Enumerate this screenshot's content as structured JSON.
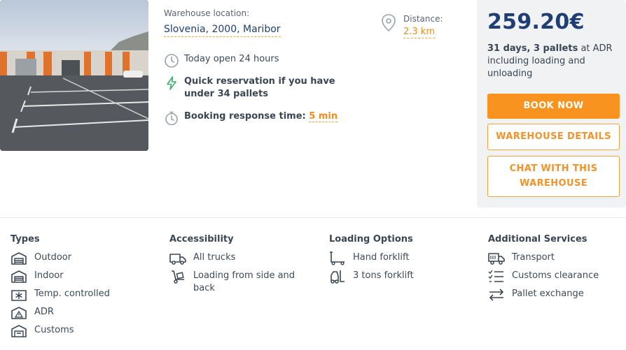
{
  "listing": {
    "location_label": "Warehouse location:",
    "location_value": "Slovenia, 2000, Maribor",
    "distance_label": "Distance:",
    "distance_value": "2.3 km",
    "open_hours": "Today open 24 hours",
    "quick_reservation": "Quick reservation if you have under 34 pallets",
    "response_label": "Booking response time:",
    "response_value": "5 min"
  },
  "pricing": {
    "price": "259.20€",
    "terms_bold": "31 days, 3 pallets",
    "terms_rest": " at ADR",
    "terms_note": "including loading and unloading",
    "book_label": "BOOK NOW",
    "details_label": "WAREHOUSE DETAILS",
    "chat_label": "CHAT WITH THIS WAREHOUSE"
  },
  "features": {
    "types": {
      "title": "Types",
      "items": [
        {
          "label": "Outdoor",
          "icon": "outdoor-warehouse-icon"
        },
        {
          "label": "Indoor",
          "icon": "indoor-warehouse-icon"
        },
        {
          "label": "Temp. controlled",
          "icon": "snowflake-icon"
        },
        {
          "label": "ADR",
          "icon": "hazard-warning-icon"
        },
        {
          "label": "Customs",
          "icon": "customs-warehouse-icon"
        }
      ]
    },
    "accessibility": {
      "title": "Accessibility",
      "items": [
        {
          "label": "All trucks",
          "icon": "truck-icon"
        },
        {
          "label": "Loading from side and back",
          "icon": "loading-dolly-icon"
        }
      ]
    },
    "loading": {
      "title": "Loading Options",
      "items": [
        {
          "label": "Hand forklift",
          "icon": "hand-forklift-icon"
        },
        {
          "label": "3 tons forklift",
          "icon": "forklift-icon"
        }
      ]
    },
    "services": {
      "title": "Additional Services",
      "items": [
        {
          "label": "Transport",
          "icon": "delivery-truck-icon"
        },
        {
          "label": "Customs clearance",
          "icon": "checklist-icon"
        },
        {
          "label": "Pallet exchange",
          "icon": "exchange-arrows-icon"
        }
      ]
    }
  },
  "colors": {
    "accent": "#f7931e",
    "navy": "#1f3f73",
    "green": "#3fb06a",
    "panel": "#f1f2f3"
  }
}
